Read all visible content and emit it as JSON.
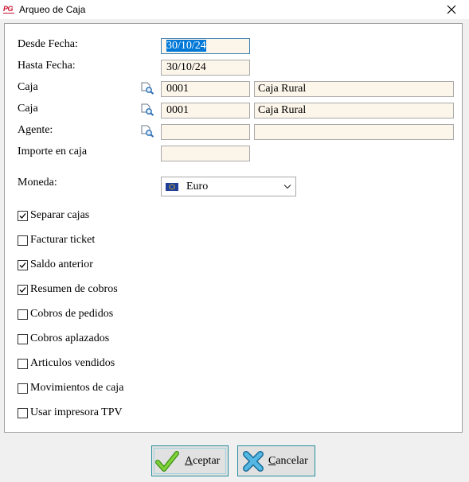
{
  "window": {
    "title": "Arqueo de Caja",
    "logo_text": "PG",
    "icons": {
      "logo": "pg-app-logo",
      "close": "close-icon"
    }
  },
  "form": {
    "desde_fecha": {
      "label": "Desde Fecha:",
      "value": "30/10/24"
    },
    "hasta_fecha": {
      "label": "Hasta Fecha:",
      "value": "30/10/24"
    },
    "caja1": {
      "label": "Caja",
      "code": "0001",
      "name": "Caja Rural"
    },
    "caja2": {
      "label": "Caja",
      "code": "0001",
      "name": "Caja Rural"
    },
    "agente": {
      "label": "Agente:",
      "code": "",
      "name": ""
    },
    "importe": {
      "label": "Importe en caja",
      "value": ""
    },
    "moneda": {
      "label": "Moneda:",
      "value": "Euro",
      "icon": "eu-flag-icon"
    }
  },
  "options": [
    {
      "label": "Separar cajas",
      "checked": true
    },
    {
      "label": "Facturar ticket",
      "checked": false
    },
    {
      "label": "Saldo anterior",
      "checked": true
    },
    {
      "label": "Resumen de cobros",
      "checked": true
    },
    {
      "label": "Cobros de pedidos",
      "checked": false
    },
    {
      "label": "Cobros aplazados",
      "checked": false
    },
    {
      "label": "Articulos vendidos",
      "checked": false
    },
    {
      "label": "Movimientos de caja",
      "checked": false
    },
    {
      "label": "Usar impresora TPV",
      "checked": false
    }
  ],
  "buttons": {
    "accept": {
      "accel": "A",
      "rest": "ceptar",
      "icon": "checkmark-icon"
    },
    "cancel": {
      "accel": "C",
      "rest": "ancelar",
      "icon": "cross-icon"
    }
  },
  "colors": {
    "field_bg": "#fcf5ea",
    "selection": "#0078d7",
    "accept_green": "#6cbf2a",
    "cancel_blue": "#3fa6d4"
  }
}
